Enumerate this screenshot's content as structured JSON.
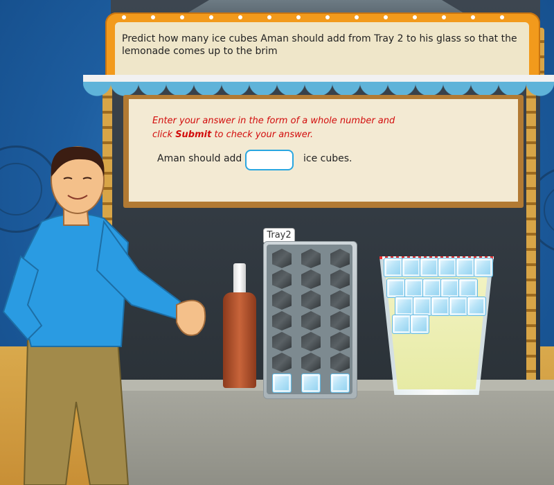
{
  "question": {
    "text": "Predict how many ice cubes Aman should add from Tray 2 to his glass so that the lemonade comes up to the brim"
  },
  "instructions": {
    "line_before": "Enter your answer in the form of a whole number and click ",
    "submit_word": "Submit",
    "line_after": " to check your answer."
  },
  "answer": {
    "label": "Aman should add",
    "value": "",
    "placeholder": "",
    "suffix": "ice cubes."
  },
  "tray": {
    "label": "Tray2",
    "rows": 7,
    "cols": 3,
    "filled_slots_bottom_row": 3
  },
  "glass": {
    "cubes_in_glass": 20
  },
  "colors": {
    "instruction_red": "#d20c0c",
    "input_border": "#29a6e0",
    "sign_orange": "#f29a1c"
  }
}
